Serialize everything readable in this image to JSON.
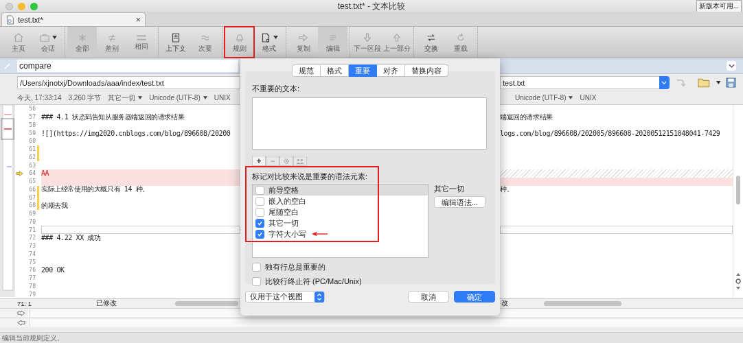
{
  "window": {
    "title": "test.txt* - 文本比较",
    "update_button": "新版本可用..."
  },
  "tabs": [
    {
      "label": "test.txt*",
      "close": "×",
      "selected": true
    }
  ],
  "toolbar": [
    {
      "items": [
        {
          "label": "主页",
          "disabled": true,
          "selected": false,
          "dropdown": false,
          "annotated": false
        },
        {
          "label": "会话",
          "disabled": true,
          "selected": false,
          "dropdown": true,
          "annotated": false
        }
      ]
    },
    {
      "items": [
        {
          "label": "全部",
          "disabled": true,
          "selected": true,
          "dropdown": false,
          "annotated": false
        },
        {
          "label": "差别",
          "disabled": true,
          "selected": false,
          "dropdown": false,
          "annotated": false
        },
        {
          "label": "相同",
          "disabled": true,
          "selected": false,
          "dropdown": false,
          "annotated": false
        }
      ]
    },
    {
      "items": [
        {
          "label": "上下文",
          "disabled": false,
          "selected": false,
          "dropdown": false,
          "annotated": false
        },
        {
          "label": "次要",
          "disabled": true,
          "selected": false,
          "dropdown": false,
          "annotated": false
        }
      ]
    },
    {
      "items": [
        {
          "label": "规则",
          "disabled": true,
          "selected": false,
          "dropdown": false,
          "annotated": true
        },
        {
          "label": "格式",
          "disabled": false,
          "selected": false,
          "dropdown": true,
          "annotated": false
        }
      ]
    },
    {
      "items": [
        {
          "label": "复制",
          "disabled": true,
          "selected": false,
          "dropdown": false,
          "annotated": false
        },
        {
          "label": "编辑",
          "disabled": true,
          "selected": true,
          "dropdown": false,
          "annotated": false
        }
      ]
    },
    {
      "items": [
        {
          "label": "下一区段",
          "disabled": true,
          "selected": false,
          "dropdown": false,
          "annotated": false
        },
        {
          "label": "上一部分",
          "disabled": true,
          "selected": false,
          "dropdown": false,
          "annotated": false
        }
      ]
    },
    {
      "items": [
        {
          "label": "交换",
          "disabled": false,
          "selected": false,
          "dropdown": false,
          "annotated": false
        },
        {
          "label": "重载",
          "disabled": true,
          "selected": false,
          "dropdown": false,
          "annotated": false
        }
      ]
    }
  ],
  "compare_field": {
    "value": "compare"
  },
  "left_pane": {
    "path": "/Users/xjnotxj/Downloads/aaa/index/test.txt",
    "info": [
      {
        "text": "今天, 17:33:14",
        "dropdown": false
      },
      {
        "text": "3,260 字节",
        "dropdown": false
      },
      {
        "text": "其它一切",
        "dropdown": true
      },
      {
        "text": "Unicode (UTF-8)",
        "dropdown": true
      },
      {
        "text": "UNIX",
        "dropdown": false
      }
    ],
    "lines": [
      {
        "number": "56",
        "kind": "plain",
        "current": false
      },
      {
        "number": "57",
        "text": "### 4.1 状态码告知从服务器端返回的请求结果",
        "kind": "plain",
        "current": false
      },
      {
        "number": "58",
        "kind": "plain",
        "current": false
      },
      {
        "number": "59",
        "text": "![](https://img2020.cnblogs.com/blog/896608/20200",
        "kind": "plain",
        "current": false
      },
      {
        "number": "60",
        "kind": "plain",
        "current": false
      },
      {
        "number": "61",
        "kind": "changed",
        "current": false
      },
      {
        "number": "62",
        "kind": "changed",
        "current": false
      },
      {
        "number": "63",
        "kind": "plain",
        "current": false
      },
      {
        "number": "64",
        "text": "AA",
        "kind": "deleted",
        "current": true
      },
      {
        "number": "65",
        "kind": "deleted",
        "current": false
      },
      {
        "number": "66",
        "text": "实际上经常使用的大概只有 14 种。",
        "kind": "changed",
        "current": false
      },
      {
        "number": "67",
        "kind": "changed",
        "current": false
      },
      {
        "number": "68",
        "text": "的期去我",
        "kind": "changed",
        "current": false
      },
      {
        "number": "69",
        "kind": "plain",
        "current": false
      },
      {
        "number": "70",
        "kind": "plain",
        "current": false
      },
      {
        "number": "71",
        "kind": "boxed",
        "current": false
      },
      {
        "number": "72",
        "text": "### 4.22 XX 成功",
        "kind": "plain",
        "current": false
      },
      {
        "number": "73",
        "kind": "plain",
        "current": false
      },
      {
        "number": "74",
        "kind": "plain",
        "current": false
      },
      {
        "number": "75",
        "kind": "plain",
        "current": false
      },
      {
        "number": "76",
        "text": "200 OK",
        "kind": "plain",
        "current": false
      },
      {
        "number": "77",
        "kind": "plain",
        "current": false
      },
      {
        "number": "78",
        "kind": "plain",
        "current": false
      },
      {
        "number": "79",
        "kind": "plain",
        "current": false
      }
    ],
    "status": [
      "71: 1",
      "已修改"
    ]
  },
  "right_pane": {
    "path": "test.txt",
    "info": [
      {
        "text": "Unicode (UTF-8)",
        "dropdown": true
      },
      {
        "text": "UNIX",
        "dropdown": false
      }
    ],
    "lines": [
      {
        "kind": "plain"
      },
      {
        "text": "端返回的请求结果",
        "kind": "plain"
      },
      {
        "kind": "plain"
      },
      {
        "text": "logs.com/blog/896608/202005/896608-20200512151048041-7429",
        "kind": "plain"
      },
      {
        "kind": "plain"
      },
      {
        "kind": "plain"
      },
      {
        "kind": "plain"
      },
      {
        "kind": "plain"
      },
      {
        "kind": "gap"
      },
      {
        "kind": "deleted"
      },
      {
        "text": "种。",
        "kind": "plain"
      },
      {
        "kind": "plain"
      },
      {
        "kind": "plain"
      },
      {
        "kind": "plain"
      },
      {
        "kind": "plain"
      },
      {
        "kind": "boxed"
      },
      {
        "kind": "plain"
      },
      {
        "kind": "plain"
      },
      {
        "kind": "plain"
      },
      {
        "kind": "plain"
      },
      {
        "kind": "plain"
      },
      {
        "kind": "plain"
      },
      {
        "kind": "plain"
      },
      {
        "kind": "plain"
      }
    ],
    "status": "改"
  },
  "dialog": {
    "tabs": [
      {
        "label": "规范",
        "selected": false
      },
      {
        "label": "格式",
        "selected": false
      },
      {
        "label": "重要",
        "selected": true
      },
      {
        "label": "对齐",
        "selected": false
      },
      {
        "label": "替换内容",
        "selected": false
      }
    ],
    "unimportant_label": "不重要的文本:",
    "list_buttons": [
      {
        "label": "+",
        "disabled": false
      },
      {
        "label": "−",
        "disabled": true
      }
    ],
    "elements_label": "标记对比较来说是重要的语法元素:",
    "elements_annotated": true,
    "elements": [
      {
        "label": "前导空格",
        "checked": false,
        "selected": true,
        "arrow": false
      },
      {
        "label": "嵌入的空白",
        "checked": false,
        "selected": false,
        "arrow": false
      },
      {
        "label": "尾随空白",
        "checked": false,
        "selected": false,
        "arrow": false
      },
      {
        "label": "其它一切",
        "checked": true,
        "selected": false,
        "arrow": false
      },
      {
        "label": "字符大小写",
        "checked": true,
        "selected": false,
        "arrow": true
      }
    ],
    "detail_label": "其它一切",
    "edit_button": "编辑语法...",
    "options": [
      {
        "label": "独有行总是重要的",
        "checked": false
      },
      {
        "label": "比较行终止符 (PC/Mac/Unix)",
        "checked": false
      }
    ],
    "scope_select": "仅用于这个视图",
    "cancel_button": "取消",
    "ok_button": "确定"
  },
  "status_bar": "编辑当前规则定义。"
}
